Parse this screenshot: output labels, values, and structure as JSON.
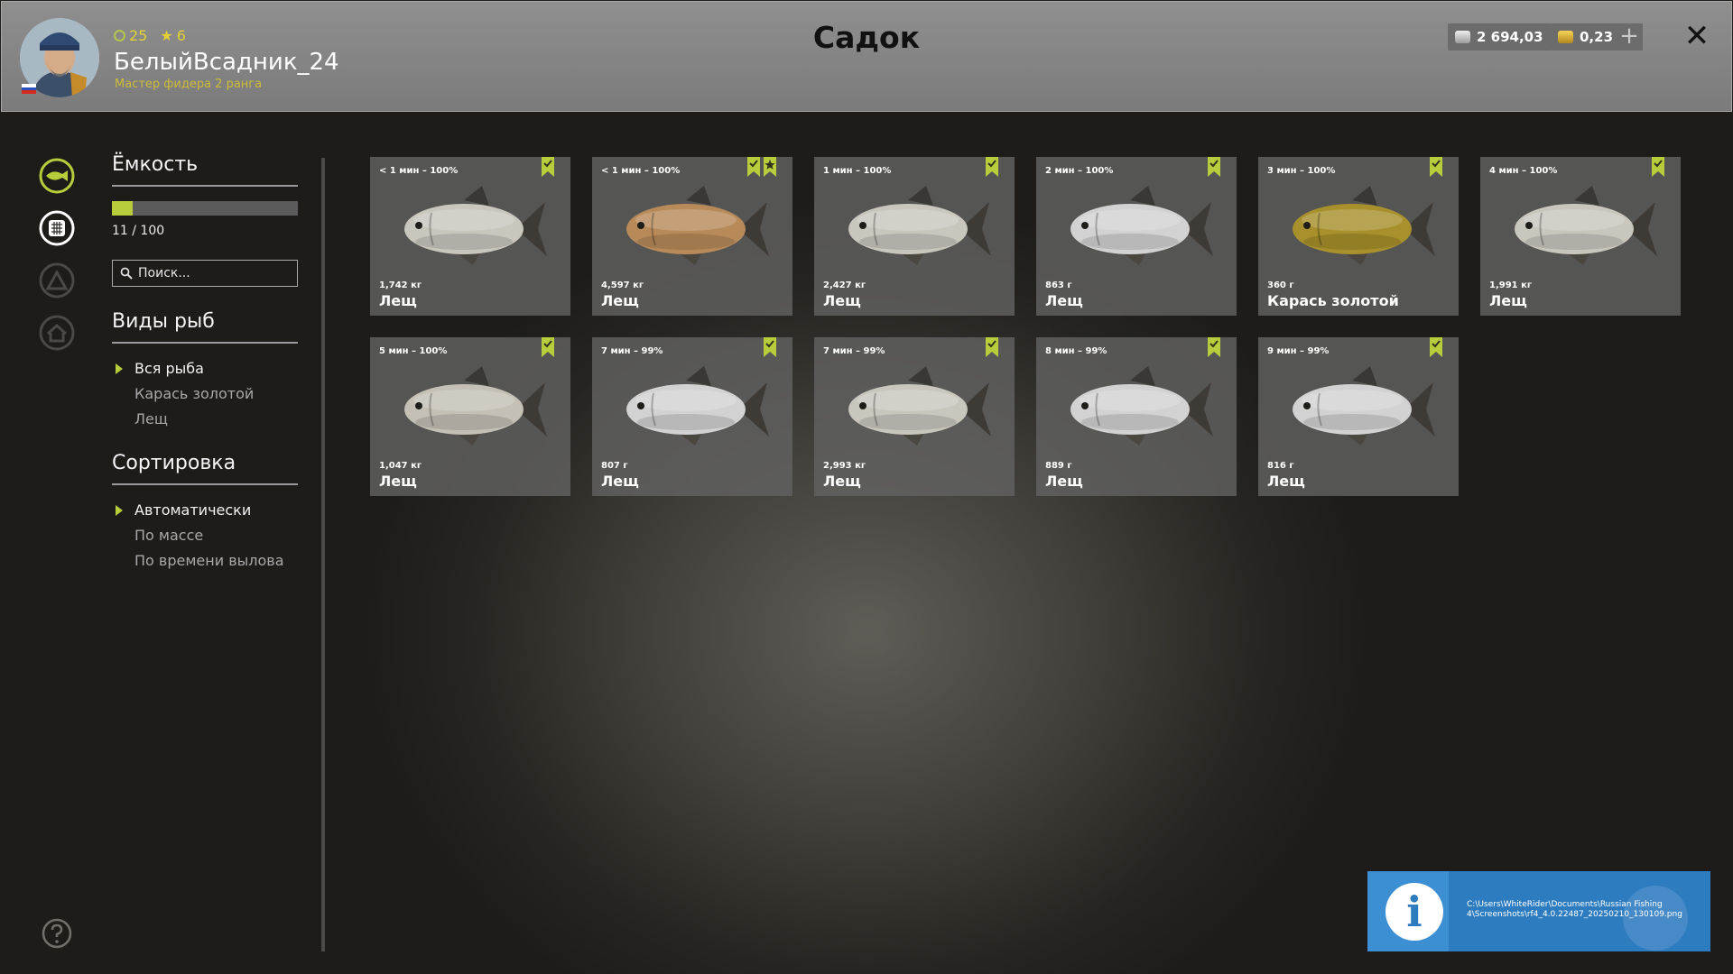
{
  "window": {
    "title": "Садок"
  },
  "player": {
    "level": "25",
    "stars": "6",
    "username": "БелыйВсадник_24",
    "rank": "Мастер фидера 2 ранга"
  },
  "currency": {
    "silver": "2 694,03",
    "gold": "0,23",
    "add_label": "+"
  },
  "close_label": "✕",
  "capacity": {
    "title": "Ёмкость",
    "text": "11 / 100",
    "fraction": 0.11
  },
  "search": {
    "placeholder": "Поиск..."
  },
  "species": {
    "title": "Виды рыб",
    "items": [
      "Вся рыба",
      "Карась золотой",
      "Лещ"
    ]
  },
  "sorting": {
    "title": "Сортировка",
    "items": [
      "Автоматически",
      "По массе",
      "По времени вылова"
    ]
  },
  "fish": [
    {
      "time": "< 1 мин – 100%",
      "weight": "1,742 кг",
      "name": "Лещ",
      "star": false,
      "color": "#c9c6bd"
    },
    {
      "time": "< 1 мин – 100%",
      "weight": "4,597 кг",
      "name": "Лещ",
      "star": true,
      "color": "#b88a5a"
    },
    {
      "time": "1 мин – 100%",
      "weight": "2,427 кг",
      "name": "Лещ",
      "star": false,
      "color": "#c9c6bd"
    },
    {
      "time": "2 мин – 100%",
      "weight": "863 г",
      "name": "Лещ",
      "star": false,
      "color": "#d2d2d2"
    },
    {
      "time": "3 мин – 100%",
      "weight": "360 г",
      "name": "Карась золотой",
      "star": false,
      "color": "#a8902c"
    },
    {
      "time": "4 мин – 100%",
      "weight": "1,991 кг",
      "name": "Лещ",
      "star": false,
      "color": "#c9c6bd"
    },
    {
      "time": "5 мин – 100%",
      "weight": "1,047 кг",
      "name": "Лещ",
      "star": false,
      "color": "#c4c0b6"
    },
    {
      "time": "7 мин – 99%",
      "weight": "807 г",
      "name": "Лещ",
      "star": false,
      "color": "#d2d2d2"
    },
    {
      "time": "7 мин – 99%",
      "weight": "2,993 кг",
      "name": "Лещ",
      "star": false,
      "color": "#c9c6bd"
    },
    {
      "time": "8 мин – 99%",
      "weight": "889 г",
      "name": "Лещ",
      "star": false,
      "color": "#d2d2d2"
    },
    {
      "time": "9 мин – 99%",
      "weight": "816 г",
      "name": "Лещ",
      "star": false,
      "color": "#d2d2d2"
    }
  ],
  "toast": {
    "icon_label": "i",
    "path": "C:\\Users\\WhiteRider\\Documents\\Russian Fishing 4\\Screenshots\\rf4_4.0.22487_20250210_130109.png"
  },
  "colors": {
    "accent": "#b8cc3c",
    "toast": "#2d7cc0"
  },
  "icons": [
    "fish-icon",
    "keepnet-icon",
    "camp-icon",
    "home-icon",
    "help-icon",
    "bookmark-icon",
    "star-icon",
    "search-icon",
    "close-icon",
    "coin-icon"
  ]
}
